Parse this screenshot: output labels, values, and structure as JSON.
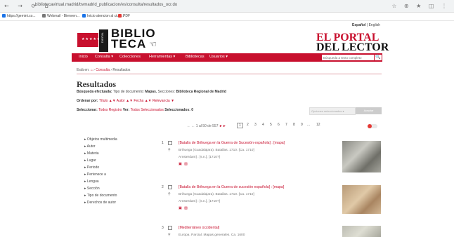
{
  "browser": {
    "nav_icons": "← → ⟳ ⌂",
    "url": "bibliotecavirtual.madrid/bvmadrid_publicacion/es/consulta/resultados_ocr.do",
    "tools": "☆ ⊕ ★ ◫ ⋮",
    "bookmarks": [
      "https://gemini.co...",
      "Webmail - Bienven...",
      "Inicio atencion al ciud...",
      "PDF"
    ],
    "bookmark_colors": [
      "#1a73e8",
      "#777777",
      "#1a73e8",
      "#e53935"
    ]
  },
  "header": {
    "lang_active": "Español",
    "lang_sep": "|",
    "lang_other": "English",
    "flag_stars": "★★★★★★★",
    "logo_vertical": "DIGITAL",
    "logo_line1": "BIBLIO",
    "logo_line2": "TECA",
    "logo_hand": "☜",
    "portal_line1": "EL PORTAL",
    "portal_line2": "DEL LECTOR"
  },
  "nav": {
    "items": [
      "Inicio",
      "Consulta ▾",
      "Colecciones",
      "Herramientas ▾",
      "Bibliotecas",
      "Usuarios ▾"
    ],
    "search_placeholder": "Búsqueda a texto completo",
    "search_icon": "🔍",
    "arrow": "⌄"
  },
  "breadcrumb": {
    "prefix": "Está en:",
    "home_icon": "⌂",
    "sep1": "›",
    "item1": "Consulta",
    "sep2": "›",
    "item2": "Resultados"
  },
  "results": {
    "title": "Resultados",
    "search_label": "Búsqueda efectuada:",
    "search_text": "Tipo de documento:",
    "search_bold1": "Mapas.",
    "search_text2": "Secciones:",
    "search_bold2": "Biblioteca Regional de Madrid",
    "sort_label": "Ordenar por:",
    "sort_options": "Título ▲▼   Autor ▲▼   Fecha ▲▼   Relevancia ▼",
    "select_label": "Seleccionar:",
    "select_all": "Todos Registro",
    "see_label": "Ver:",
    "see_selected": "Todos Seleccionados",
    "selected_count": "Seleccionados: 0",
    "filter_placeholder": "Opciones seleccionados ▾",
    "filter_button": "Aceptar",
    "pager_prefix": "← ← 1 al 50 de 557",
    "pager_arrows": "►►",
    "pages": [
      "1",
      "2",
      "3",
      "4",
      "5",
      "6",
      "7",
      "8",
      "9",
      "...",
      "12"
    ]
  },
  "sidebar": {
    "items": [
      "▸ Objetos multimedia",
      "▸ Autor",
      "▸ Materia",
      "▸ Lugar",
      "▸ Periodo",
      "▸ Pertenece a",
      "▸ Lengua",
      "▸ Sección",
      "▸ Tipo de documento",
      "▸ Derechos de autor"
    ]
  },
  "records": [
    {
      "num": "1",
      "title": "[Batalla de Brihuega en la Guerra de Sucesión española] : [mapa]",
      "line1": "Brihuega (Guadalajara). Batallas. 1710. [Ca. 1710]",
      "line2": "Amsterdam] : [s.n.], [1710?]",
      "icons": "▣ ▨"
    },
    {
      "num": "2",
      "title": "[Batalla de Brihuega en la Guerra de sucesión española] : [mapa]",
      "line1": "Brihuega (Guadalajara). Batallas. 1710. [Ca. 1710]",
      "line2": "Amsterdam] : [s.n.], [1710?]",
      "icons": "▣ ▨"
    },
    {
      "num": "3",
      "title": "[Mediterráneo occidental]",
      "line1": "Europa. Parcial. Mapas generales. Ca. 1600",
      "line2": "",
      "icons": ""
    }
  ]
}
